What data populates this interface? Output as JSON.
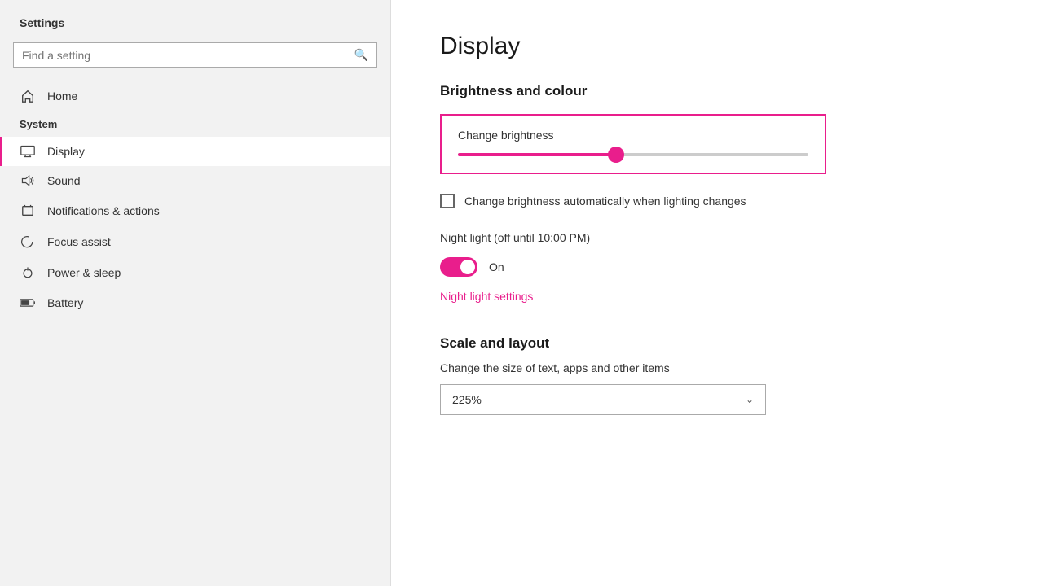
{
  "sidebar": {
    "app_title": "Settings",
    "search_placeholder": "Find a setting",
    "system_label": "System",
    "nav_items": [
      {
        "id": "home",
        "label": "Home",
        "icon": "home"
      },
      {
        "id": "display",
        "label": "Display",
        "icon": "display",
        "active": true
      },
      {
        "id": "sound",
        "label": "Sound",
        "icon": "sound"
      },
      {
        "id": "notifications",
        "label": "Notifications & actions",
        "icon": "notifications"
      },
      {
        "id": "focus",
        "label": "Focus assist",
        "icon": "focus"
      },
      {
        "id": "power",
        "label": "Power & sleep",
        "icon": "power"
      },
      {
        "id": "battery",
        "label": "Battery",
        "icon": "battery"
      }
    ]
  },
  "main": {
    "page_title": "Display",
    "brightness_section_title": "Brightness and colour",
    "brightness_label": "Change brightness",
    "auto_brightness_label": "Change brightness automatically when lighting changes",
    "night_light_label": "Night light (off until 10:00 PM)",
    "night_light_toggle_label": "On",
    "night_light_link": "Night light settings",
    "scale_section_title": "Scale and layout",
    "scale_desc": "Change the size of text, apps and other items",
    "scale_value": "225%"
  },
  "icons": {
    "home": "⌂",
    "display": "▭",
    "sound": "🔊",
    "notifications": "🔔",
    "focus": "☽",
    "power": "⏻",
    "battery": "🔋",
    "search": "🔍",
    "chevron_down": "▾"
  }
}
